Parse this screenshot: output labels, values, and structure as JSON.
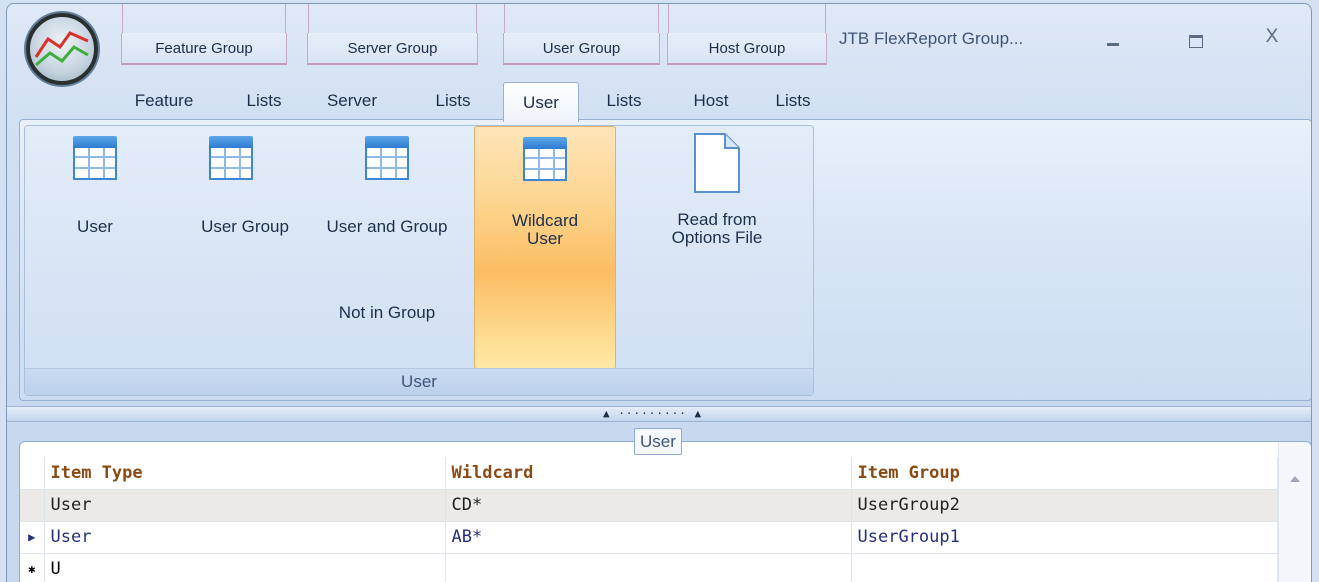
{
  "window": {
    "title": "JTB FlexReport Group...",
    "controls": {
      "minimize": "minimize",
      "maximize": "maximize",
      "close": "X"
    }
  },
  "tab_groups": [
    {
      "label": "Feature Group"
    },
    {
      "label": "Server Group"
    },
    {
      "label": "User Group"
    },
    {
      "label": "Host Group"
    }
  ],
  "tabs": [
    {
      "label": "Feature"
    },
    {
      "label": "Lists"
    },
    {
      "label": "Server"
    },
    {
      "label": "Lists"
    },
    {
      "label": "User"
    },
    {
      "label": "Lists"
    },
    {
      "label": "Host"
    },
    {
      "label": "Lists"
    }
  ],
  "ribbon": {
    "group_caption": "User",
    "buttons": {
      "user": "User",
      "user_group": "User Group",
      "user_and_group": "User and Group",
      "not_in_group": "Not in Group",
      "wildcard_line1": "Wildcard",
      "wildcard_line2": "User",
      "read_options_line1": "Read from",
      "read_options_line2": "Options File"
    }
  },
  "panel": {
    "caption": "User",
    "columns": [
      "Item Type",
      "Wildcard",
      "Item Group"
    ],
    "rows": [
      {
        "item_type": "User",
        "wildcard": "CD*",
        "item_group": "UserGroup2"
      },
      {
        "item_type": "User",
        "wildcard": "AB*",
        "item_group": "UserGroup1"
      },
      {
        "item_type": "U",
        "wildcard": "",
        "item_group": ""
      }
    ]
  },
  "colors": {
    "accent_active_button": "#fbbd63",
    "header_text": "#8a4a14",
    "current_row_text": "#23307e"
  }
}
